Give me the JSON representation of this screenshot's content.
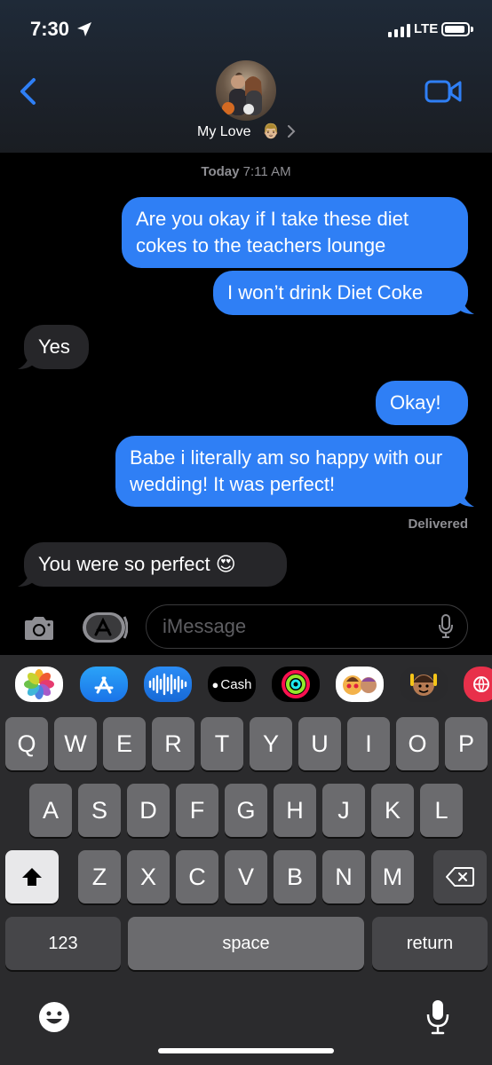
{
  "status_bar": {
    "time": "7:30",
    "network": "LTE",
    "icons": [
      "location-arrow-icon",
      "signal-icon",
      "battery-icon"
    ]
  },
  "header": {
    "contact_name": "My Love",
    "contact_emoji": "👨🏼",
    "icons": [
      "back-chevron-icon",
      "video-call-icon",
      "chevron-right-icon"
    ],
    "accent_color": "#2f7ff5"
  },
  "conversation": {
    "timestamp_day": "Today",
    "timestamp_time": "7:11 AM",
    "messages": [
      {
        "direction": "outgoing",
        "text": "Are you okay if I take these diet cokes to the teachers lounge"
      },
      {
        "direction": "outgoing",
        "text": "I won’t drink Diet Coke"
      },
      {
        "direction": "incoming",
        "text": "Yes"
      },
      {
        "direction": "outgoing",
        "text": "Okay!"
      },
      {
        "direction": "outgoing",
        "text": "Babe i literally am so happy with our wedding! It was perfect!"
      },
      {
        "direction": "incoming",
        "text": "You were so perfect 😍"
      }
    ],
    "delivered_label": "Delivered",
    "colors": {
      "outgoing": "#2f7ff5",
      "incoming": "#262629"
    }
  },
  "input_bar": {
    "placeholder": "iMessage",
    "icons": [
      "camera-icon",
      "app-store-icon",
      "microphone-icon"
    ]
  },
  "app_strip": {
    "apps": [
      {
        "name": "photos-app-icon"
      },
      {
        "name": "app-store-app-icon"
      },
      {
        "name": "audio-message-app-icon"
      },
      {
        "name": "apple-cash-app-icon",
        "label": "Cash"
      },
      {
        "name": "activity-app-icon"
      },
      {
        "name": "memoji-stickers-app-icon"
      },
      {
        "name": "memoji-app-icon"
      },
      {
        "name": "web-app-icon"
      }
    ]
  },
  "keyboard": {
    "row1": [
      "Q",
      "W",
      "E",
      "R",
      "T",
      "Y",
      "U",
      "I",
      "O",
      "P"
    ],
    "row2": [
      "A",
      "S",
      "D",
      "F",
      "G",
      "H",
      "J",
      "K",
      "L"
    ],
    "row3": [
      "Z",
      "X",
      "C",
      "V",
      "B",
      "N",
      "M"
    ],
    "numbers_label": "123",
    "space_label": "space",
    "return_label": "return",
    "icons": [
      "shift-icon",
      "delete-icon",
      "emoji-icon",
      "dictation-icon"
    ]
  }
}
